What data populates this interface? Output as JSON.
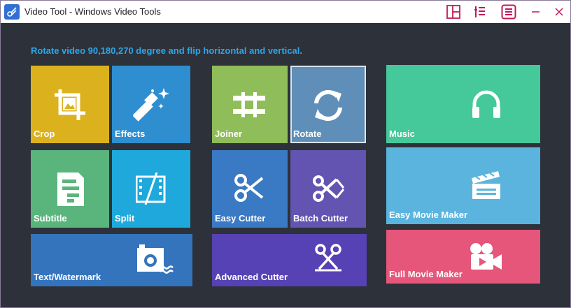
{
  "window": {
    "title": "Video Tool - Windows Video Tools"
  },
  "headline": "Rotate video 90,180,270 degree and flip horizontal and vertical.",
  "tiles": {
    "crop": {
      "label": "Crop",
      "icon": "crop-icon",
      "color": "#dbb21d"
    },
    "effects": {
      "label": "Effects",
      "icon": "magic-wand-icon",
      "color": "#2e8ed0"
    },
    "joiner": {
      "label": "Joiner",
      "icon": "joiner-icon",
      "color": "#8fbd59"
    },
    "rotate": {
      "label": "Rotate",
      "icon": "rotate-icon",
      "color": "#5f8fb8",
      "selected": true
    },
    "music": {
      "label": "Music",
      "icon": "headphones-icon",
      "color": "#45c89a"
    },
    "subtitle": {
      "label": "Subtitle",
      "icon": "subtitle-icon",
      "color": "#5ab57c"
    },
    "split": {
      "label": "Split",
      "icon": "film-split-icon",
      "color": "#1fa8dc"
    },
    "easy_cutter": {
      "label": "Easy Cutter",
      "icon": "scissors-icon",
      "color": "#3a7ac4"
    },
    "batch_cutter": {
      "label": "Batch Cutter",
      "icon": "batch-scissors-icon",
      "color": "#6254b0"
    },
    "easy_movie_maker": {
      "label": "Easy Movie Maker",
      "icon": "clapperboard-icon",
      "color": "#5ab4de"
    },
    "text_watermark": {
      "label": "Text/Watermark",
      "icon": "camera-watermark-icon",
      "color": "#3474bd"
    },
    "advanced_cutter": {
      "label": "Advanced Cutter",
      "icon": "advanced-scissors-icon",
      "color": "#5642b4"
    },
    "full_movie_maker": {
      "label": "Full Movie Maker",
      "icon": "movie-camera-icon",
      "color": "#e6557a"
    }
  }
}
